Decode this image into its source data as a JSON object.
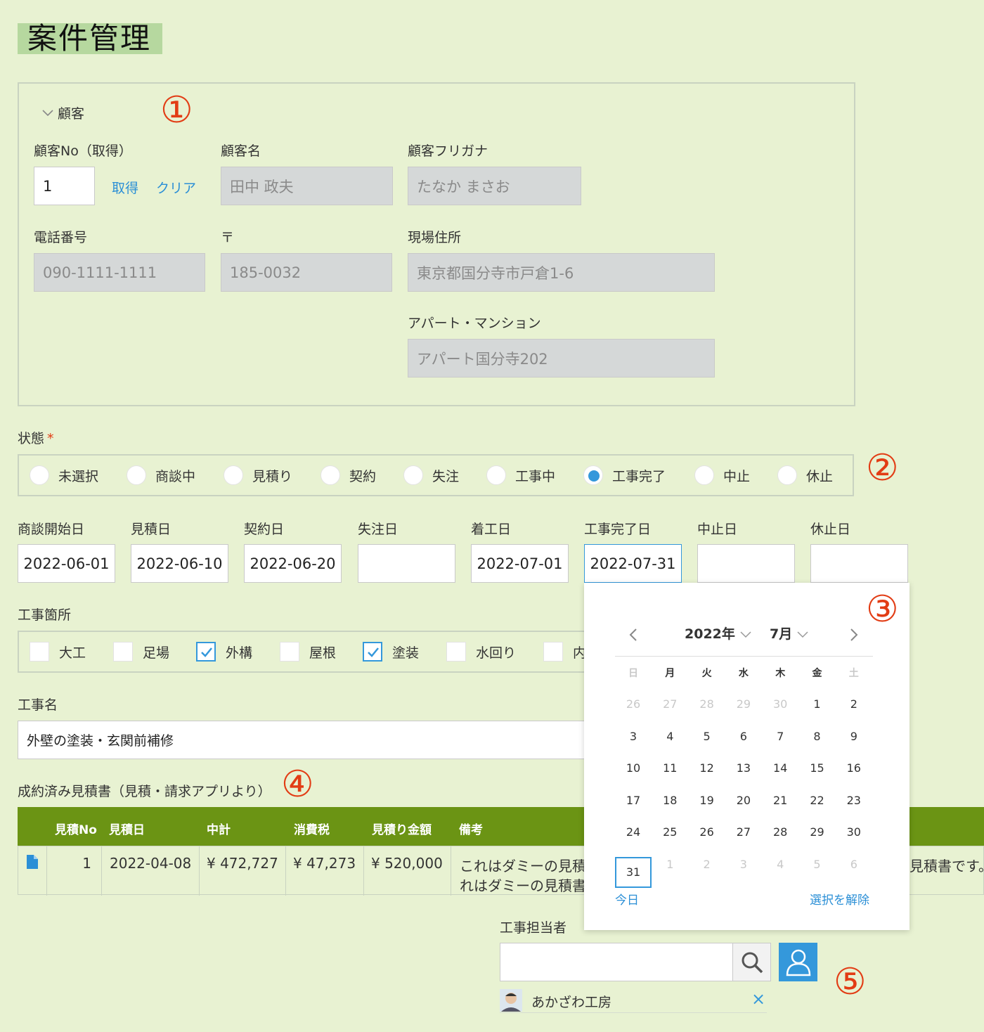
{
  "page_title": "案件管理",
  "annotations": {
    "n1": "①",
    "n2": "②",
    "n3": "③",
    "n4": "④",
    "n5": "⑤"
  },
  "customer": {
    "group_label": "顧客",
    "no_label": "顧客No（取得）",
    "no_value": "1",
    "get_link": "取得",
    "clear_link": "クリア",
    "name_label": "顧客名",
    "name_value": "田中 政夫",
    "kana_label": "顧客フリガナ",
    "kana_value": "たなか まさお",
    "phone_label": "電話番号",
    "phone_value": "090-1111-1111",
    "zip_label": "〒",
    "zip_value": "185-0032",
    "address_label": "現場住所",
    "address_value": "東京都国分寺市戸倉1-6",
    "apartment_label": "アパート・マンション",
    "apartment_value": "アパート国分寺202"
  },
  "status": {
    "label": "状態",
    "required_mark": "*",
    "options": [
      "未選択",
      "商談中",
      "見積り",
      "契約",
      "失注",
      "工事中",
      "工事完了",
      "中止",
      "休止"
    ],
    "selected": "工事完了"
  },
  "dates": [
    {
      "label": "商談開始日",
      "value": "2022-06-01"
    },
    {
      "label": "見積日",
      "value": "2022-06-10"
    },
    {
      "label": "契約日",
      "value": "2022-06-20"
    },
    {
      "label": "失注日",
      "value": ""
    },
    {
      "label": "着工日",
      "value": "2022-07-01"
    },
    {
      "label": "工事完了日",
      "value": "2022-07-31"
    },
    {
      "label": "中止日",
      "value": ""
    },
    {
      "label": "休止日",
      "value": ""
    }
  ],
  "work_parts": {
    "label": "工事箇所",
    "options": [
      {
        "label": "大工",
        "checked": false
      },
      {
        "label": "足場",
        "checked": false
      },
      {
        "label": "外構",
        "checked": true
      },
      {
        "label": "屋根",
        "checked": false
      },
      {
        "label": "塗装",
        "checked": true
      },
      {
        "label": "水回り",
        "checked": false
      },
      {
        "label": "内",
        "checked": false
      }
    ]
  },
  "work_name": {
    "label": "工事名",
    "value": "外壁の塗装・玄関前補修"
  },
  "estimates": {
    "label": "成約済み見積書（見積・請求アプリより）",
    "columns": [
      "見積No",
      "見積日",
      "中計",
      "消費税",
      "見積り金額",
      "備考"
    ],
    "rows": [
      {
        "no": "1",
        "date": "2022-04-08",
        "subtotal": "¥ 472,727",
        "tax": "¥ 47,273",
        "total": "¥ 520,000",
        "note_line1": "これはダミーの見積書",
        "note_line2": "れはダミーの見積書で",
        "note_right": "見積書です。"
      }
    ]
  },
  "calendar": {
    "year": "2022年",
    "month": "7月",
    "weekdays": [
      "日",
      "月",
      "火",
      "水",
      "木",
      "金",
      "土"
    ],
    "weeks": [
      [
        "26",
        "27",
        "28",
        "29",
        "30",
        "1",
        "2"
      ],
      [
        "3",
        "4",
        "5",
        "6",
        "7",
        "8",
        "9"
      ],
      [
        "10",
        "11",
        "12",
        "13",
        "14",
        "15",
        "16"
      ],
      [
        "17",
        "18",
        "19",
        "20",
        "21",
        "22",
        "23"
      ],
      [
        "24",
        "25",
        "26",
        "27",
        "28",
        "29",
        "30"
      ],
      [
        "31",
        "1",
        "2",
        "3",
        "4",
        "5",
        "6"
      ]
    ],
    "today_link": "今日",
    "clear_link": "選択を解除"
  },
  "assignee": {
    "label": "工事担当者",
    "input_value": "",
    "selected_user": "あかざわ工房",
    "remove_icon": "×"
  }
}
